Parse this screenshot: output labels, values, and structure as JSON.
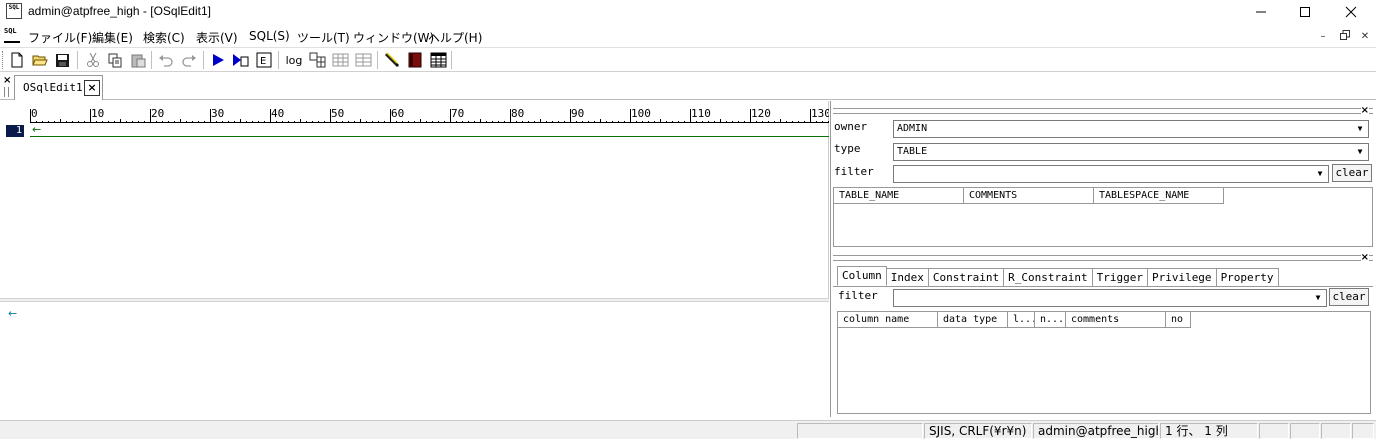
{
  "window": {
    "title": "admin@atpfree_high - [OSqlEdit1]",
    "icon_text": "SQL",
    "minimize": "—",
    "maximize": "☐",
    "close": "✕"
  },
  "menu": {
    "icon_text": "SQL",
    "items": [
      "ファイル(F)",
      "編集(E)",
      "検索(C)",
      "表示(V)",
      "SQL(S)",
      "ツール(T)",
      "ウィンドウ(W)",
      "ヘルプ(H)"
    ],
    "mdi_minimize": "–",
    "mdi_restore": "🗗",
    "mdi_close": "✕"
  },
  "toolbar": {
    "log_label": "log",
    "icons": [
      "new-file-icon",
      "open-folder-icon",
      "save-icon",
      "cut-icon",
      "copy-icon",
      "paste-icon",
      "undo-icon",
      "redo-icon",
      "run-icon",
      "run-to-cursor-icon",
      "explain-icon",
      "log-icon",
      "grid-icon-1",
      "grid-icon-2",
      "grid-icon-3",
      "pencil-icon",
      "book-icon",
      "table-icon"
    ]
  },
  "tabs": {
    "close_all": "×",
    "doc_tab_label": "OSqlEdit1",
    "doc_tab_close": "×"
  },
  "editor": {
    "ruler_labels": [
      "0",
      "10",
      "20",
      "30",
      "40",
      "50",
      "60",
      "70",
      "80",
      "90",
      "100",
      "110",
      "120",
      "130"
    ],
    "line_number": "1",
    "eol_mark": "←",
    "output_eol": "←"
  },
  "object_panel": {
    "close": "×",
    "owner_label": "owner",
    "owner_value": "ADMIN",
    "type_label": "type",
    "type_value": "TABLE",
    "filter_label": "filter",
    "filter_value": "",
    "clear_label": "clear",
    "columns": [
      "TABLE_NAME",
      "COMMENTS",
      "TABLESPACE_NAME"
    ]
  },
  "detail_panel": {
    "close": "×",
    "tabs": [
      "Column",
      "Index",
      "Constraint",
      "R_Constraint",
      "Trigger",
      "Privilege",
      "Property"
    ],
    "active_tab": "Column",
    "filter_label": "filter",
    "filter_value": "",
    "clear_label": "clear",
    "columns": [
      "column name",
      "data type",
      "l...",
      "n...",
      "comments",
      "no"
    ]
  },
  "status": {
    "encoding": "SJIS, CRLF(¥r¥n)",
    "connection": "admin@atpfree_high",
    "position": "1 行、 1 列"
  }
}
